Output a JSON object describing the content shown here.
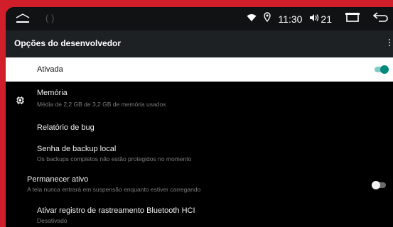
{
  "status_bar": {
    "time": "11:30",
    "volume": "21",
    "home_icon": "home-outline-icon",
    "wifi_icon": "wifi-icon",
    "location_icon": "location-pin-icon",
    "volume_icon": "volume-icon",
    "recents_icon": "recent-apps-icon",
    "back_icon": "back-arrow-icon"
  },
  "app_bar": {
    "title": "Opções do desenvolvedor"
  },
  "master_switch": {
    "label": "Ativada",
    "state": "on"
  },
  "items": [
    {
      "title": "Memória",
      "subtitle": "Média de 2,2 GB de 3,2 GB de memória usados",
      "icon": "memory-chip-icon"
    },
    {
      "title": "Relatório de bug"
    },
    {
      "title": "Senha de backup local",
      "subtitle": "Os backups completos não estão protegidos no momento"
    },
    {
      "title": "Permanecer ativo",
      "subtitle": "A tela nunca entrará em suspensão enquanto estiver carregando",
      "toggle": "off"
    },
    {
      "title": "Ativar registro de rastreamento Bluetooth HCI",
      "subtitle": "Desativado"
    }
  ],
  "colors": {
    "frame": "#d01f2a",
    "background": "#000000",
    "app_bar": "#1e2124",
    "accent": "#00897b"
  }
}
